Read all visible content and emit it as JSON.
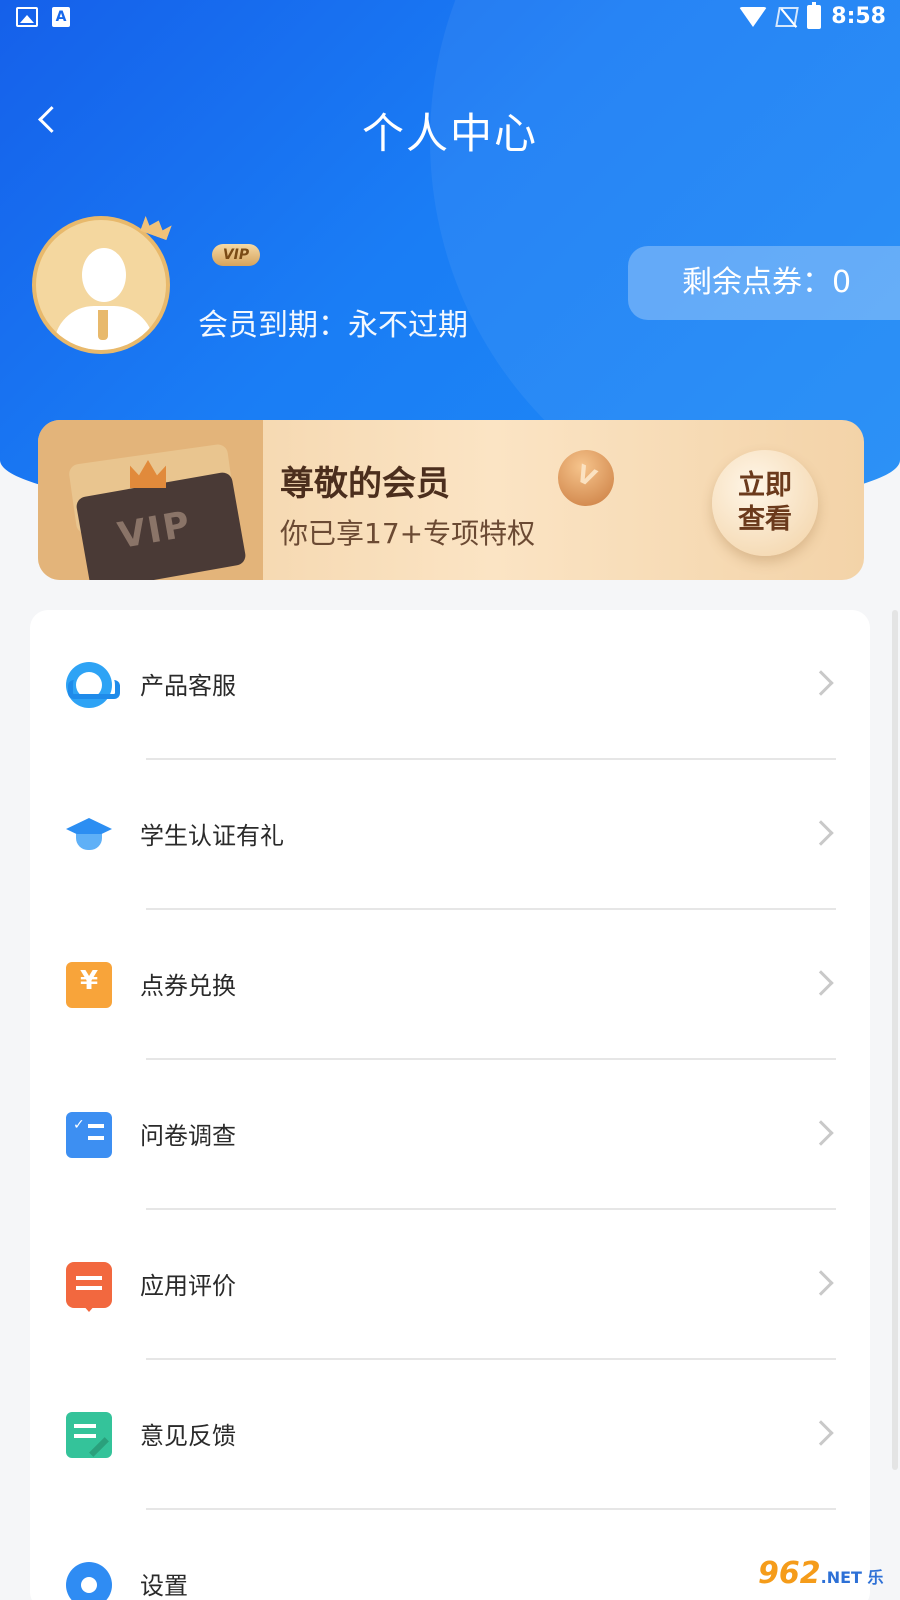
{
  "status_bar": {
    "time": "8:58"
  },
  "header": {
    "title": "个人中心"
  },
  "profile": {
    "vip_badge": "VIP",
    "expiry": "会员到期：永不过期",
    "points": "剩余点券：0"
  },
  "banner": {
    "card_text": "VIP",
    "title": "尊敬的会员",
    "subtitle": "你已享17+专项特权",
    "button": "立即查看"
  },
  "menu": {
    "items": [
      {
        "label": "产品客服",
        "icon": "headset-icon"
      },
      {
        "label": "学生认证有礼",
        "icon": "graduation-cap-icon"
      },
      {
        "label": "点券兑换",
        "icon": "ticket-icon"
      },
      {
        "label": "问卷调查",
        "icon": "survey-icon"
      },
      {
        "label": "应用评价",
        "icon": "review-icon"
      },
      {
        "label": "意见反馈",
        "icon": "feedback-icon"
      },
      {
        "label": "设置",
        "icon": "gear-icon"
      }
    ]
  },
  "watermark": {
    "text": "962",
    "sub": ".NET 乐游网"
  },
  "colors": {
    "primary": "#1668ec",
    "gold": "#e8b96c"
  }
}
